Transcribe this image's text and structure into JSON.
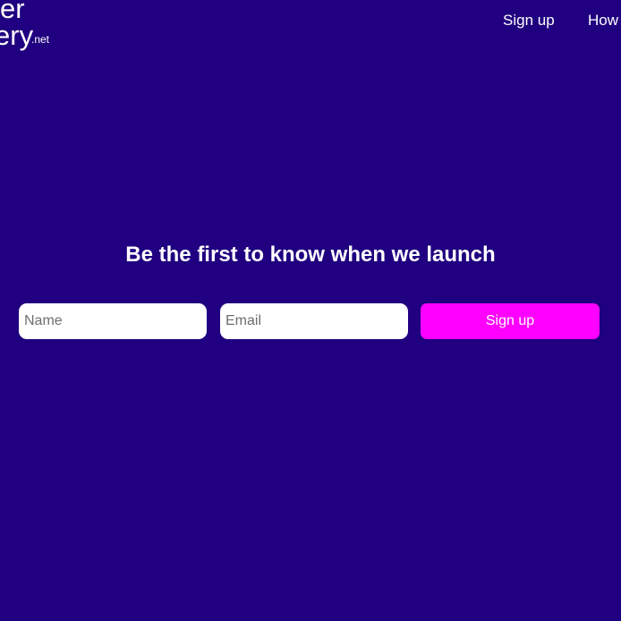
{
  "header": {
    "logo": {
      "line1": "er",
      "line2": "ery",
      "tld": ".net"
    },
    "nav": [
      {
        "label": "Sign up"
      },
      {
        "label": "How"
      }
    ]
  },
  "hero": {
    "headline": "Be the first to know when we launch"
  },
  "form": {
    "name_placeholder": "Name",
    "email_placeholder": "Email",
    "submit_label": "Sign up"
  },
  "colors": {
    "background": "#200080",
    "accent": "#ff00ff",
    "text": "#ffffff"
  }
}
